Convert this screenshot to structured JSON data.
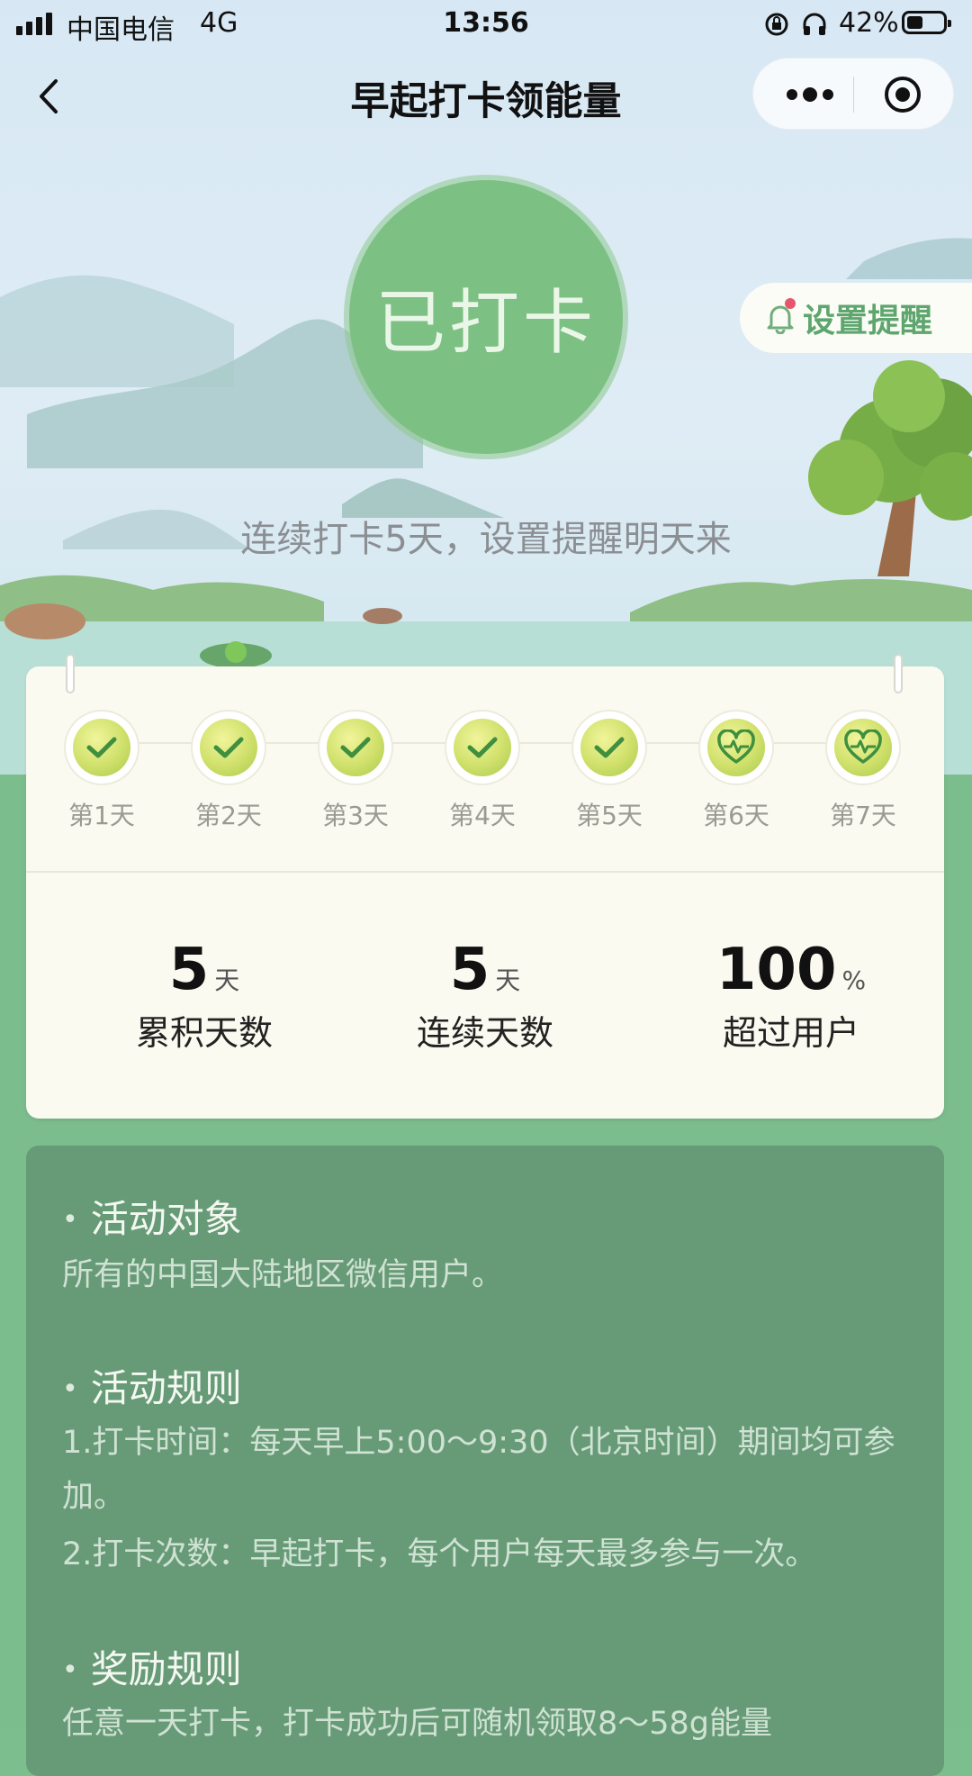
{
  "status_bar": {
    "carrier": "中国电信",
    "network": "4G",
    "time": "13:56",
    "battery": "42%",
    "battery_level": 0.42
  },
  "nav": {
    "title": "早起打卡领能量"
  },
  "hero": {
    "checkin_label": "已打卡",
    "reminder_label": "设置提醒",
    "tip": "连续打卡5天，设置提醒明天来"
  },
  "week": {
    "days": [
      {
        "label": "第1天",
        "state": "checked"
      },
      {
        "label": "第2天",
        "state": "checked"
      },
      {
        "label": "第3天",
        "state": "checked"
      },
      {
        "label": "第4天",
        "state": "checked"
      },
      {
        "label": "第5天",
        "state": "checked"
      },
      {
        "label": "第6天",
        "state": "heart"
      },
      {
        "label": "第7天",
        "state": "heart"
      }
    ]
  },
  "stats": [
    {
      "value": "5",
      "unit": "天",
      "caption": "累积天数"
    },
    {
      "value": "5",
      "unit": "天",
      "caption": "连续天数"
    },
    {
      "value": "100",
      "unit": "%",
      "caption": "超过用户"
    }
  ],
  "rules": {
    "target_heading": "活动对象",
    "target_text": "所有的中国大陆地区微信用户。",
    "rules_heading": "活动规则",
    "rule_1": "1.打卡时间：每天早上5:00～9:30（北京时间）期间均可参加。",
    "rule_2": "2.打卡次数：早起打卡，每个用户每天最多参与一次。",
    "reward_heading": "奖励规则",
    "reward_text": "任意一天打卡，打卡成功后可随机领取8～58g能量"
  },
  "colors": {
    "accent_green": "#7dc083",
    "panel_green": "#679b77",
    "badge_dot": "#e5566d"
  }
}
